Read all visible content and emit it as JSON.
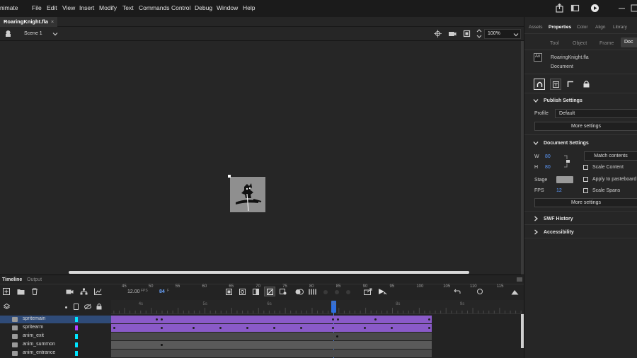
{
  "menubar": {
    "app_name": "nimate",
    "items": [
      "File",
      "Edit",
      "View",
      "Insert",
      "Modify",
      "Text",
      "Commands",
      "Control",
      "Debug",
      "Window",
      "Help"
    ]
  },
  "document": {
    "tab_title": "RoaringKnight.fla",
    "tab_close": "×",
    "scene_label": "Scene 1",
    "zoom": "100%"
  },
  "timeline": {
    "tabs": [
      "Timeline",
      "Output"
    ],
    "fps_value": "12.00",
    "fps_unit": "FPS",
    "frame_value": "84",
    "frame_unit": "F",
    "ruler_labels": [
      "45",
      "50",
      "55",
      "60",
      "65",
      "70",
      "75",
      "80",
      "85",
      "90",
      "95",
      "100",
      "105",
      "110",
      "115"
    ],
    "ruler_second_labels": [
      "4s",
      "5s",
      "6s",
      "7s",
      "8s",
      "9s"
    ],
    "layers": [
      {
        "name": "spritemain",
        "color": "#00e5ff",
        "selected": true
      },
      {
        "name": "spritearm",
        "color": "#b040ff",
        "selected": false
      },
      {
        "name": "anim_exit",
        "color": "#00e5ff",
        "selected": false
      },
      {
        "name": "anim_summon",
        "color": "#00e5ff",
        "selected": false
      },
      {
        "name": "anim_entrance",
        "color": "#00e5ff",
        "selected": false
      }
    ]
  },
  "properties_panel": {
    "top_tabs": [
      "Assets",
      "Properties",
      "Color",
      "Align",
      "Library"
    ],
    "active_top_tab": "Properties",
    "sub_tabs": [
      "Tool",
      "Object",
      "Frame",
      "Doc"
    ],
    "active_sub_tab": "Doc",
    "doc_name": "RoaringKnight.fla",
    "doc_type": "Document",
    "publish_settings": {
      "title": "Publish Settings",
      "profile_label": "Profile",
      "profile_value": "Default",
      "more_settings": "More settings"
    },
    "document_settings": {
      "title": "Document Settings",
      "w_label": "W",
      "w_value": "80",
      "h_label": "H",
      "h_value": "80",
      "match_contents": "Match contents",
      "scale_content": "Scale Content",
      "stage_label": "Stage",
      "apply_to_pasteboard": "Apply to pasteboard",
      "fps_label": "FPS",
      "fps_value": "12",
      "scale_spans": "Scale Spans",
      "more_settings": "More settings"
    },
    "swf_history": "SWF History",
    "accessibility": "Accessibility"
  },
  "colors": {
    "accent_blue": "#4a90ff",
    "purple_span": "#8a5ac8",
    "selection_blue": "#2a4a7a"
  }
}
